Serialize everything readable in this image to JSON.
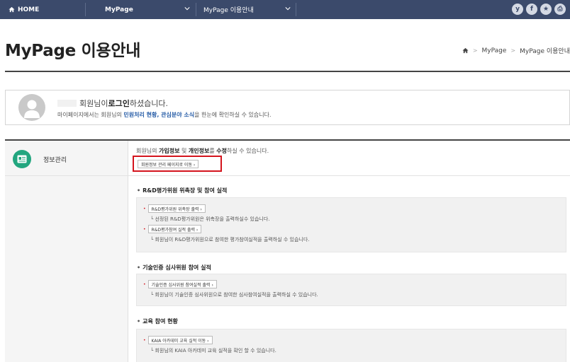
{
  "topbar": {
    "home": "HOME",
    "menu1": "MyPage",
    "menu2": "MyPage 이용안내",
    "social": [
      "y",
      "f",
      "★",
      "⎙"
    ]
  },
  "page": {
    "title": "MyPage 이용안내",
    "breadcrumb": [
      "MyPage",
      "MyPage 이용안내"
    ]
  },
  "login": {
    "suffix_pre": "회원님이 ",
    "suffix_bold": "로그인",
    "suffix_post": "하셨습니다.",
    "desc_pre": "마이페이지에서는 회원님의 ",
    "desc_hl": "민원처리 현황, 관심분야 소식",
    "desc_post": "을 한눈에 확인하실 수 있습니다."
  },
  "info": {
    "label": "정보관리",
    "desc_pre": "회원님의 ",
    "desc_b1": "가입정보",
    "desc_mid": " 및 ",
    "desc_b2": "개인정보",
    "desc_post": "를 ",
    "desc_b3": "수정",
    "desc_end": "하실 수 있습니다.",
    "profile_btn": "회원정보 관리 페이지로 이동 ›"
  },
  "sections": [
    {
      "title": "R&D평가위원 위촉장 및 참여 실적",
      "items": [
        {
          "btn": "R&D평가위원 위촉장 출력 ›",
          "note": "└ 선정된 R&D평가위원은 위촉장을 출력하실수 있습니다."
        },
        {
          "btn": "R&D평가참여 실적 출력 ›",
          "note": "└ 회원님이 R&D평가위원으로 참여한 평가참여실적을 출력하실 수 있습니다."
        }
      ]
    },
    {
      "title": "기술인증 심사위원 참여 실적",
      "items": [
        {
          "btn": "기술인증 심사위원 참여실적 출력 ›",
          "note": "└ 회원님이 기술인증 심사위원으로 참여한 심사참여실적을 출력하실 수 있습니다."
        }
      ]
    },
    {
      "title": "교육 참여 현황",
      "items": [
        {
          "btn": "KAIA 아카데미 교육 실적 이동 ›",
          "note": "└ 회원님의 KAIA 아카데미 교육 실적을 확인 할 수 있습니다."
        }
      ]
    }
  ],
  "colors": {
    "topbar": "#3b4a6b",
    "accent_green": "#22a67f",
    "highlight_red": "#d4141d",
    "link_blue": "#2a5fa8"
  }
}
